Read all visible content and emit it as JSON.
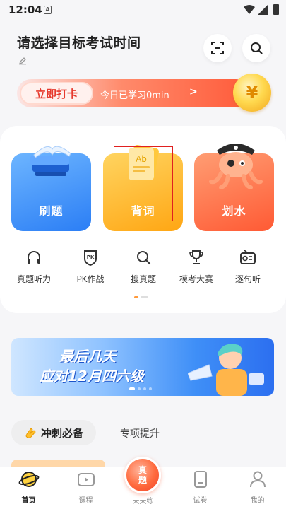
{
  "status_bar": {
    "time": "12:04",
    "a_glyph": "A"
  },
  "header": {
    "title": "请选择目标考试时间"
  },
  "checkin": {
    "button_label": "立即打卡",
    "study_text": "今日已学习0min",
    "arrow": ">",
    "coin_glyph": "¥"
  },
  "features": [
    {
      "label": "刷题",
      "icon": "book-stack-icon"
    },
    {
      "label": "背词",
      "icon": "vocab-card-icon"
    },
    {
      "label": "划水",
      "icon": "pirate-octopus-icon"
    }
  ],
  "tools": [
    {
      "label": "真题听力",
      "icon": "headphones-icon"
    },
    {
      "label": "PK作战",
      "icon": "pk-shield-icon"
    },
    {
      "label": "搜真题",
      "icon": "search-icon"
    },
    {
      "label": "模考大赛",
      "icon": "trophy-icon"
    },
    {
      "label": "逐句听",
      "icon": "radio-icon"
    }
  ],
  "pk_badge_text": "PK",
  "promo": {
    "line1": "最后几天",
    "line2": "应对12月四六级"
  },
  "tabs": {
    "active": "冲刺必备",
    "other": "专项提升"
  },
  "bottom_nav": [
    {
      "label": "首页",
      "icon": "planet-icon",
      "active": true
    },
    {
      "label": "课程",
      "icon": "video-icon",
      "active": false
    },
    {
      "label": "天天练",
      "icon": "daily-practice-icon",
      "active": false
    },
    {
      "label": "试卷",
      "icon": "paper-icon",
      "active": false
    },
    {
      "label": "我的",
      "icon": "user-icon",
      "active": false
    }
  ],
  "center_button": {
    "line1": "真",
    "line2": "题"
  },
  "colors": {
    "accent_red": "#e63a2e",
    "blue_card": "#2b7ef5",
    "yellow_card": "#ffa613",
    "orange_card": "#ff5a34"
  }
}
